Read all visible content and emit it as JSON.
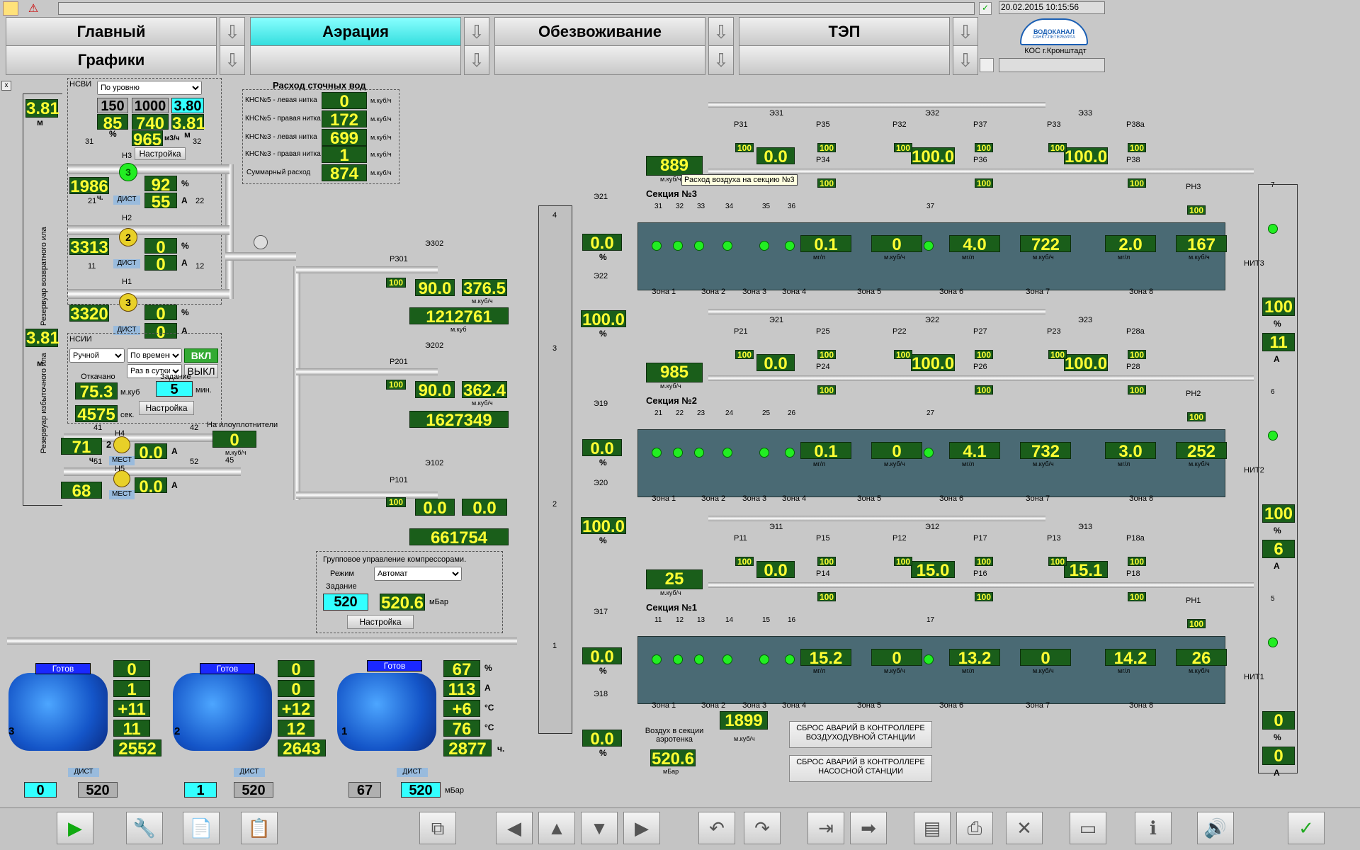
{
  "datetime": "20.02.2015 10:15:56",
  "logo": {
    "text": "ВОДОКАНАЛ",
    "sub": "САНКТ-ПЕТЕРБУРГА",
    "site": "КОС г.Кронштадт"
  },
  "nav": [
    {
      "label": "Главный"
    },
    {
      "label": "Аэрация"
    },
    {
      "label": "Обезвоживание"
    },
    {
      "label": "ТЭП"
    },
    {
      "label": "Графики"
    },
    {
      "label": ""
    },
    {
      "label": ""
    },
    {
      "label": ""
    }
  ],
  "left": {
    "level_top": "3.81",
    "level_top_unit": "м",
    "level_mid": "3.81",
    "level_mid_unit": "м",
    "reservoir1": "Резервуар возвратного ила",
    "reservoir2": "Резервуар избыточного ила",
    "nsvi_label": "НСВИ",
    "nsvi_mode": "По уровню",
    "sp1": "150",
    "sp2": "1000",
    "sp3": "3.80",
    "pct": "85",
    "pct_u": "%",
    "flow": "740",
    "lvl": "3.81",
    "lvl_u": "м",
    "flow2": "965",
    "flow2_u": "м3/ч",
    "settings": "Настройка",
    "pumps": [
      {
        "name": "Н3",
        "num": "3",
        "hours": "1986",
        "h_u": "ч.",
        "pct": "92",
        "pct_u": "%",
        "amp": "55",
        "amp_u": "А",
        "mode": "ДИСТ",
        "v1": "31",
        "v2": "32"
      },
      {
        "name": "Н2",
        "num": "2",
        "hours": "3313",
        "h_u": "ч.",
        "pct": "0",
        "pct_u": "%",
        "amp": "0",
        "amp_u": "А",
        "mode": "ДИСТ",
        "v1": "21",
        "v2": "22"
      },
      {
        "name": "Н1",
        "num": "3",
        "hours": "3320",
        "h_u": "ч.",
        "pct": "0",
        "pct_u": "%",
        "amp": "0",
        "amp_u": "А",
        "mode": "ДИСТ",
        "v1": "11",
        "v2": "12"
      }
    ],
    "nsii_label": "НСИИ",
    "nsii_mode": "Ручной",
    "nsii_time": "По времени",
    "nsii_period": "Раз в сутки",
    "on": "ВКЛ",
    "off": "ВЫКЛ",
    "pumped_lbl": "Откачано",
    "pumped": "75.3",
    "pumped_u": "м.куб",
    "task_lbl": "Задание",
    "task": "5",
    "task_u": "мин.",
    "sec": "4575",
    "sec_u": "сек.",
    "settings2": "Настройка",
    "h4": {
      "name": "Н4",
      "num": "2",
      "hours": "71",
      "h_u": "ч.",
      "amp": "0.0",
      "amp_u": "А",
      "mode": "МЕСТ",
      "v1": "41",
      "v2": "42"
    },
    "h5": {
      "name": "Н5",
      "num": "1",
      "hours": "68",
      "amp": "0.0",
      "amp_u": "А",
      "mode": "МЕСТ",
      "v1": "51",
      "v2": "52"
    },
    "seal_lbl": "На илоуплотнители",
    "seal": "0",
    "seal_u": "м.куб/ч",
    "v45": "45"
  },
  "flows": {
    "title": "Расход сточных вод",
    "rows": [
      {
        "label": "КНС№5 - левая нитка",
        "value": "0",
        "unit": "м.куб/ч"
      },
      {
        "label": "КНС№5 - правая нитка",
        "value": "172",
        "unit": "м.куб/ч"
      },
      {
        "label": "КНС№3 - левая нитка",
        "value": "699",
        "unit": "м.куб/ч"
      },
      {
        "label": "КНС№3 - правая нитка",
        "value": "1",
        "unit": "м.куб/ч"
      },
      {
        "label": "Суммарный расход",
        "value": "874",
        "unit": "м.куб/ч"
      }
    ]
  },
  "distribution": [
    {
      "r": "Р301",
      "rv": "100",
      "e": "Э302",
      "pct": "90.0",
      "flow": "376.5",
      "flow_u": "м.куб/ч",
      "total": "1212761",
      "total_u": "м.куб"
    },
    {
      "r": "Р201",
      "rv": "100",
      "e": "Э202",
      "pct": "90.0",
      "flow": "362.4",
      "flow_u": "м.куб/ч",
      "total": "1627349",
      "total_u": "м.куб"
    },
    {
      "r": "Р101",
      "rv": "100",
      "e": "Э102",
      "pct": "0.0",
      "flow": "0.0",
      "flow_u": "м.куб/ч",
      "total": "661754",
      "total_u": "м.куб"
    }
  ],
  "group": {
    "title": "Групповое управление компрессорами.",
    "mode_lbl": "Режим",
    "mode": "Автомат",
    "task_lbl": "Задание",
    "task": "520",
    "actual": "520.6",
    "unit": "мБар",
    "settings": "Настройка"
  },
  "compressors": [
    {
      "num": "3",
      "status": "Готов",
      "pct": "0",
      "amp": "1",
      "t1": "+11",
      "t2": "11",
      "hours": "2552",
      "mode": "ДИСТ",
      "sp": "0",
      "press": "520"
    },
    {
      "num": "2",
      "status": "Готов",
      "pct": "0",
      "amp": "0",
      "t1": "+12",
      "t2": "12",
      "hours": "2643",
      "mode": "ДИСТ",
      "sp": "1",
      "press": "520"
    },
    {
      "num": "1",
      "status": "Готов",
      "pct": "67",
      "amp": "113",
      "t1": "+6",
      "t2": "76",
      "hours": "2877",
      "mode": "ДИСТ",
      "sp": "67",
      "press": "520"
    }
  ],
  "units": {
    "pct": "%",
    "amp": "А",
    "deg": "°С",
    "h": "ч.",
    "mbar": "мБар"
  },
  "collector": {
    "n4": "4",
    "n3": "3",
    "n2": "2",
    "n1": "1"
  },
  "air": {
    "e21": "Э21",
    "e21v": "0.0",
    "e22": "Э22",
    "e22v": "100.0",
    "e19": "Э19",
    "e19v": "0.0",
    "e20": "Э20",
    "e20v": "100.0",
    "e17": "Э17",
    "e17v": "0.0",
    "e18": "Э18",
    "e18v": "0.0",
    "pct": "%",
    "air_lbl": "Воздух в секции аэротенка",
    "air_val": "520.6",
    "air_u": "мБар",
    "total": "1899",
    "total_u": "м.куб/ч"
  },
  "tooltip": "Расход воздуха на секцию №3",
  "sections": [
    {
      "name": "Секция №3",
      "air": "889",
      "air_u": "м.куб/ч",
      "e": "Э31",
      "ev": "0.0",
      "ea": "Э32",
      "eav": "100.0",
      "eb": "Э33",
      "ebv": "100.0",
      "r": [
        "Р31",
        "Р35",
        "Р34",
        "Р32",
        "Р37",
        "Р36",
        "Р33",
        "Р38а",
        "Р38",
        "РН3"
      ],
      "probes": [
        "31",
        "32",
        "33",
        "34",
        "35",
        "36",
        "37"
      ],
      "vals": [
        {
          "v": "0.1",
          "u": "мг/л"
        },
        {
          "v": "0",
          "u": "м.куб/ч"
        },
        {
          "v": "4.0",
          "u": "мг/л"
        },
        {
          "v": "722",
          "u": "м.куб/ч"
        },
        {
          "v": "2.0",
          "u": "мг/л"
        },
        {
          "v": "167",
          "u": "м.куб/ч"
        }
      ],
      "nit": "НИТ3",
      "nit_pct": "100",
      "nit_amp": "11",
      "probe": "7"
    },
    {
      "name": "Секция №2",
      "air": "985",
      "air_u": "м.куб/ч",
      "e": "Э21",
      "ev": "0.0",
      "ea": "Э22",
      "eav": "100.0",
      "eb": "Э23",
      "ebv": "100.0",
      "r": [
        "Р21",
        "Р25",
        "Р24",
        "Р22",
        "Р27",
        "Р26",
        "Р23",
        "Р28а",
        "Р28",
        "РН2"
      ],
      "probes": [
        "21",
        "22",
        "23",
        "24",
        "25",
        "26",
        "27"
      ],
      "vals": [
        {
          "v": "0.1",
          "u": "мг/л"
        },
        {
          "v": "0",
          "u": "м.куб/ч"
        },
        {
          "v": "4.1",
          "u": "мг/л"
        },
        {
          "v": "732",
          "u": "м.куб/ч"
        },
        {
          "v": "3.0",
          "u": "мг/л"
        },
        {
          "v": "252",
          "u": "м.куб/ч"
        }
      ],
      "nit": "НИТ2",
      "nit_pct": "100",
      "nit_amp": "6",
      "probe": "6"
    },
    {
      "name": "Секция №1",
      "air": "25",
      "air_u": "м.куб/ч",
      "e": "Э11",
      "ev": "0.0",
      "ea": "Э12",
      "eav": "15.0",
      "eb": "Э13",
      "ebv": "15.1",
      "r": [
        "Р11",
        "Р15",
        "Р14",
        "Р12",
        "Р17",
        "Р16",
        "Р13",
        "Р18а",
        "Р18",
        "РН1"
      ],
      "probes": [
        "11",
        "12",
        "13",
        "14",
        "15",
        "16",
        "17"
      ],
      "vals": [
        {
          "v": "15.2",
          "u": "мг/л"
        },
        {
          "v": "0",
          "u": "м.куб/ч"
        },
        {
          "v": "13.2",
          "u": "мг/л"
        },
        {
          "v": "0",
          "u": "м.куб/ч"
        },
        {
          "v": "14.2",
          "u": "мг/л"
        },
        {
          "v": "26",
          "u": "м.куб/ч"
        }
      ],
      "nit": "НИТ1",
      "nit_pct": "0",
      "nit_amp": "0",
      "probe": "5"
    }
  ],
  "zones": [
    "Зона 1",
    "Зона 2",
    "Зона 3",
    "Зона 4",
    "Зона 5",
    "Зона 6",
    "Зона 7",
    "Зона 8"
  ],
  "valve_pct": "100",
  "alarms": [
    "СБРОС АВАРИЙ В КОНТРОЛЛЕРЕ ВОЗДУХОДУВНОЙ СТАНЦИИ",
    "СБРОС АВАРИЙ В КОНТРОЛЛЕРЕ НАСОСНОЙ СТАНЦИИ"
  ],
  "toolbar": [
    "play-icon",
    "wrench-icon",
    "notes-icon",
    "report-icon",
    "copy-screen-icon",
    "arrow-left-icon",
    "arrow-up-icon",
    "arrow-down-icon",
    "arrow-right-icon",
    "undo-icon",
    "redo-icon",
    "export-icon",
    "forward-icon",
    "pages-icon",
    "print-icon",
    "delete-icon",
    "monitor-icon",
    "info-icon",
    "sound-icon",
    "acknowledge-icon"
  ],
  "colors": {
    "lcd_bg": "#1a5e1a",
    "lcd_text": "#ffff33",
    "cyan": "#33ffff",
    "tank": "#4a6a74",
    "ok": "#22ee22"
  }
}
